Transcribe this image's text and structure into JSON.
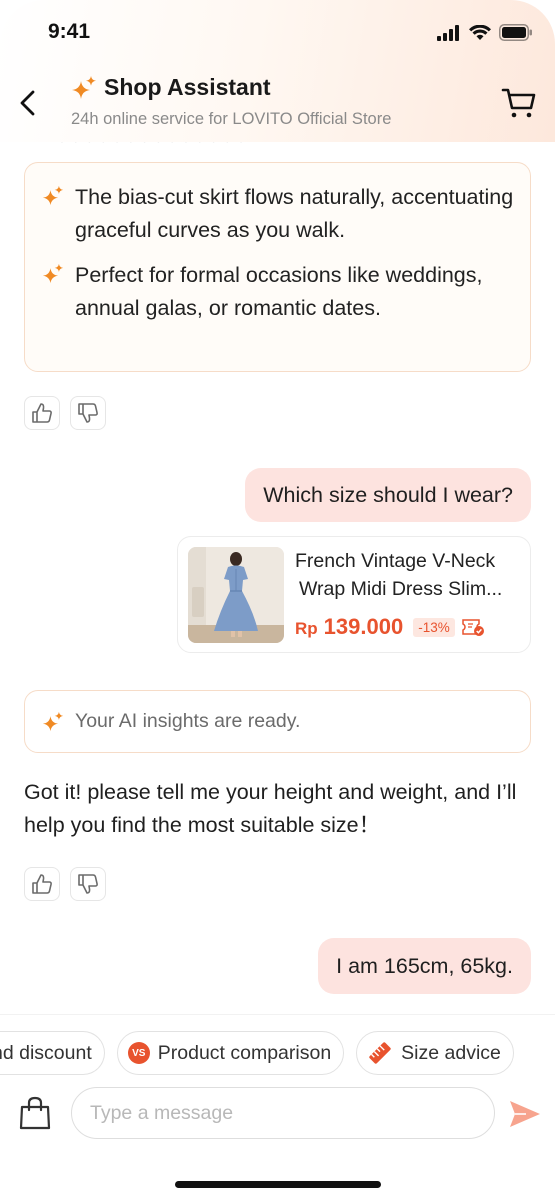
{
  "status_bar": {
    "time": "9:41"
  },
  "header": {
    "title": "Shop Assistant",
    "subtitle": "24h online service for LOVITO Official Store",
    "back_icon": "chevron-left-icon",
    "cart_icon": "cart-icon",
    "title_icon": "sparkle-icon"
  },
  "conversation": {
    "bullet_card": {
      "items": [
        "The bias-cut skirt flows naturally, accentuating graceful curves as you walk.",
        "Perfect for formal occasions like weddings, annual galas, or romantic dates."
      ]
    },
    "user_message_1": "Which size should I wear?",
    "product": {
      "name_line1": "French Vintage V-Neck",
      "name_line2": "Wrap Midi Dress Slim...",
      "currency": "Rp",
      "price": "139.000",
      "discount": "-13%",
      "coupon_icon": "coupon-icon"
    },
    "insight_text": "Your AI insights are ready.",
    "bot_message": "Got it! please tell me your height and weight, and I’ll help you find the most suitable size！",
    "user_message_2": "I am 165cm, 65kg."
  },
  "quick_replies": [
    {
      "label": "nd discount",
      "icon": ""
    },
    {
      "label": "Product comparison",
      "icon": "vs-icon"
    },
    {
      "label": "Size advice",
      "icon": "ruler-icon"
    }
  ],
  "vs_icon_text": "VS",
  "composer": {
    "placeholder": "Type a message",
    "bag_icon": "shopping-bag-icon",
    "send_icon": "send-icon"
  },
  "colors": {
    "accent": "#e8532e",
    "sparkle": "#f08a24",
    "user_bubble": "#fde3df",
    "card_border": "#f6dcc8"
  }
}
